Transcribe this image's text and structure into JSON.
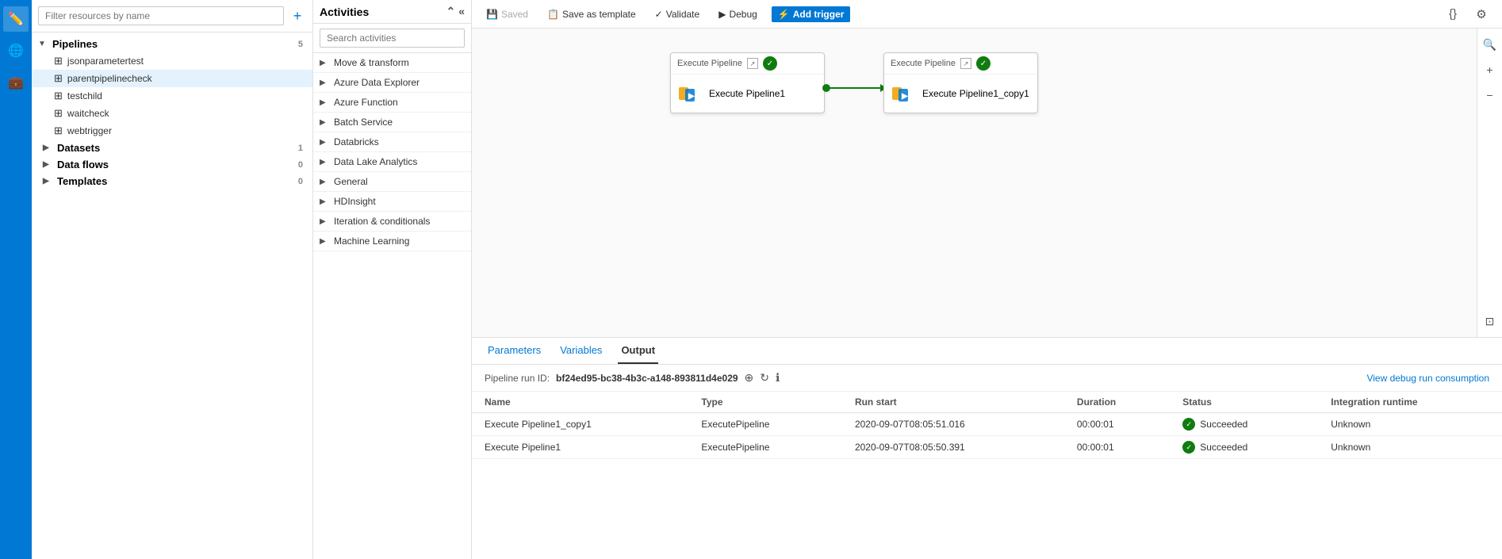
{
  "sidebar": {
    "icons": [
      "pencil-icon",
      "globe-icon",
      "briefcase-icon"
    ]
  },
  "resource_panel": {
    "search_placeholder": "Filter resources by name",
    "pipelines_label": "Pipelines",
    "pipelines_count": "5",
    "pipeline_items": [
      "jsonparametertest",
      "parentpipelinecheck",
      "testchild",
      "waitcheck",
      "webtrigger"
    ],
    "datasets_label": "Datasets",
    "datasets_count": "1",
    "dataflows_label": "Data flows",
    "dataflows_count": "0",
    "templates_label": "Templates",
    "templates_count": "0"
  },
  "activities_panel": {
    "title": "Activities",
    "search_placeholder": "Search activities",
    "groups": [
      "Move & transform",
      "Azure Data Explorer",
      "Azure Function",
      "Batch Service",
      "Databricks",
      "Data Lake Analytics",
      "General",
      "HDInsight",
      "Iteration & conditionals",
      "Machine Learning"
    ]
  },
  "toolbar": {
    "saved_label": "Saved",
    "save_template_label": "Save as template",
    "validate_label": "Validate",
    "debug_label": "Debug",
    "add_trigger_label": "Add trigger"
  },
  "canvas": {
    "node1": {
      "header": "Execute Pipeline",
      "name": "Execute Pipeline1"
    },
    "node2": {
      "header": "Execute Pipeline",
      "name": "Execute Pipeline1_copy1"
    }
  },
  "bottom_panel": {
    "tabs": [
      "Parameters",
      "Variables",
      "Output"
    ],
    "active_tab": "Output",
    "run_id_label": "Pipeline run ID:",
    "run_id_value": "bf24ed95-bc38-4b3c-a148-893811d4e029",
    "view_debug_link": "View debug run consumption",
    "table_headers": [
      "Name",
      "Type",
      "Run start",
      "Duration",
      "Status",
      "Integration runtime"
    ],
    "rows": [
      {
        "name": "Execute Pipeline1_copy1",
        "type": "ExecutePipeline",
        "run_start": "2020-09-07T08:05:51.016",
        "duration": "00:00:01",
        "status": "Succeeded",
        "runtime": "Unknown"
      },
      {
        "name": "Execute Pipeline1",
        "type": "ExecutePipeline",
        "run_start": "2020-09-07T08:05:50.391",
        "duration": "00:00:01",
        "status": "Succeeded",
        "runtime": "Unknown"
      }
    ]
  }
}
